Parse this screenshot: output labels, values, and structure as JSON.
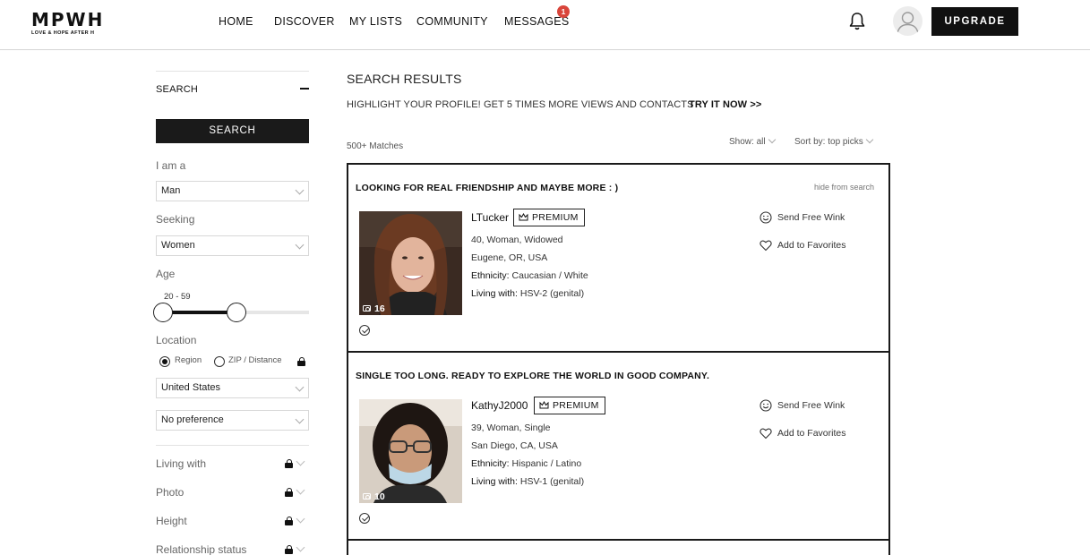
{
  "brand": {
    "name": "MPWH",
    "tagline": "LOVE & HOPE AFTER H"
  },
  "nav": {
    "home": "HOME",
    "discover": "DISCOVER",
    "my_lists": "MY LISTS",
    "community": "COMMUNITY",
    "messages": "MESSAGES",
    "messages_badge": "1",
    "upgrade": "UPGRADE"
  },
  "sidebar": {
    "heading": "SEARCH",
    "search_button": "SEARCH",
    "i_am_label": "I am a",
    "i_am_value": "Man",
    "seeking_label": "Seeking",
    "seeking_value": "Women",
    "age_label": "Age",
    "age_value": "20 - 59",
    "location_label": "Location",
    "region_label": "Region",
    "zip_label": "ZIP / Distance",
    "country_value": "United States",
    "region_value": "No preference",
    "filters": [
      "Living with",
      "Photo",
      "Height",
      "Relationship status"
    ]
  },
  "results": {
    "title": "SEARCH RESULTS",
    "highlight_text": "HIGHLIGHT YOUR PROFILE! GET 5 TIMES MORE VIEWS AND CONTACTS",
    "try_link": "TRY IT NOW >>",
    "matches": "500+ Matches",
    "show_label": "Show: all",
    "sort_label": "Sort by: top picks",
    "hide_label": "hide from search",
    "premium_label": "PREMIUM",
    "wink_label": "Send Free Wink",
    "favorite_label": "Add to Favorites",
    "ethnicity_key": "Ethnicity:",
    "living_key": "Living with:",
    "cards": [
      {
        "headline": "LOOKING FOR REAL FRIENDSHIP AND MAYBE MORE : )",
        "username": "LTucker",
        "photo_count": "16",
        "details": "40, Woman, Widowed",
        "location": "Eugene, OR, USA",
        "ethnicity": "Caucasian / White",
        "living_with": "HSV-2 (genital)"
      },
      {
        "headline": "SINGLE TOO LONG. READY TO EXPLORE THE WORLD IN GOOD COMPANY.",
        "username": "KathyJ2000",
        "photo_count": "10",
        "details": "39, Woman, Single",
        "location": "San Diego, CA, USA",
        "ethnicity": "Hispanic / Latino",
        "living_with": "HSV-1 (genital)"
      }
    ]
  },
  "colors": {
    "dark": "#111111",
    "badge": "#d9453b",
    "muted": "#666666"
  }
}
